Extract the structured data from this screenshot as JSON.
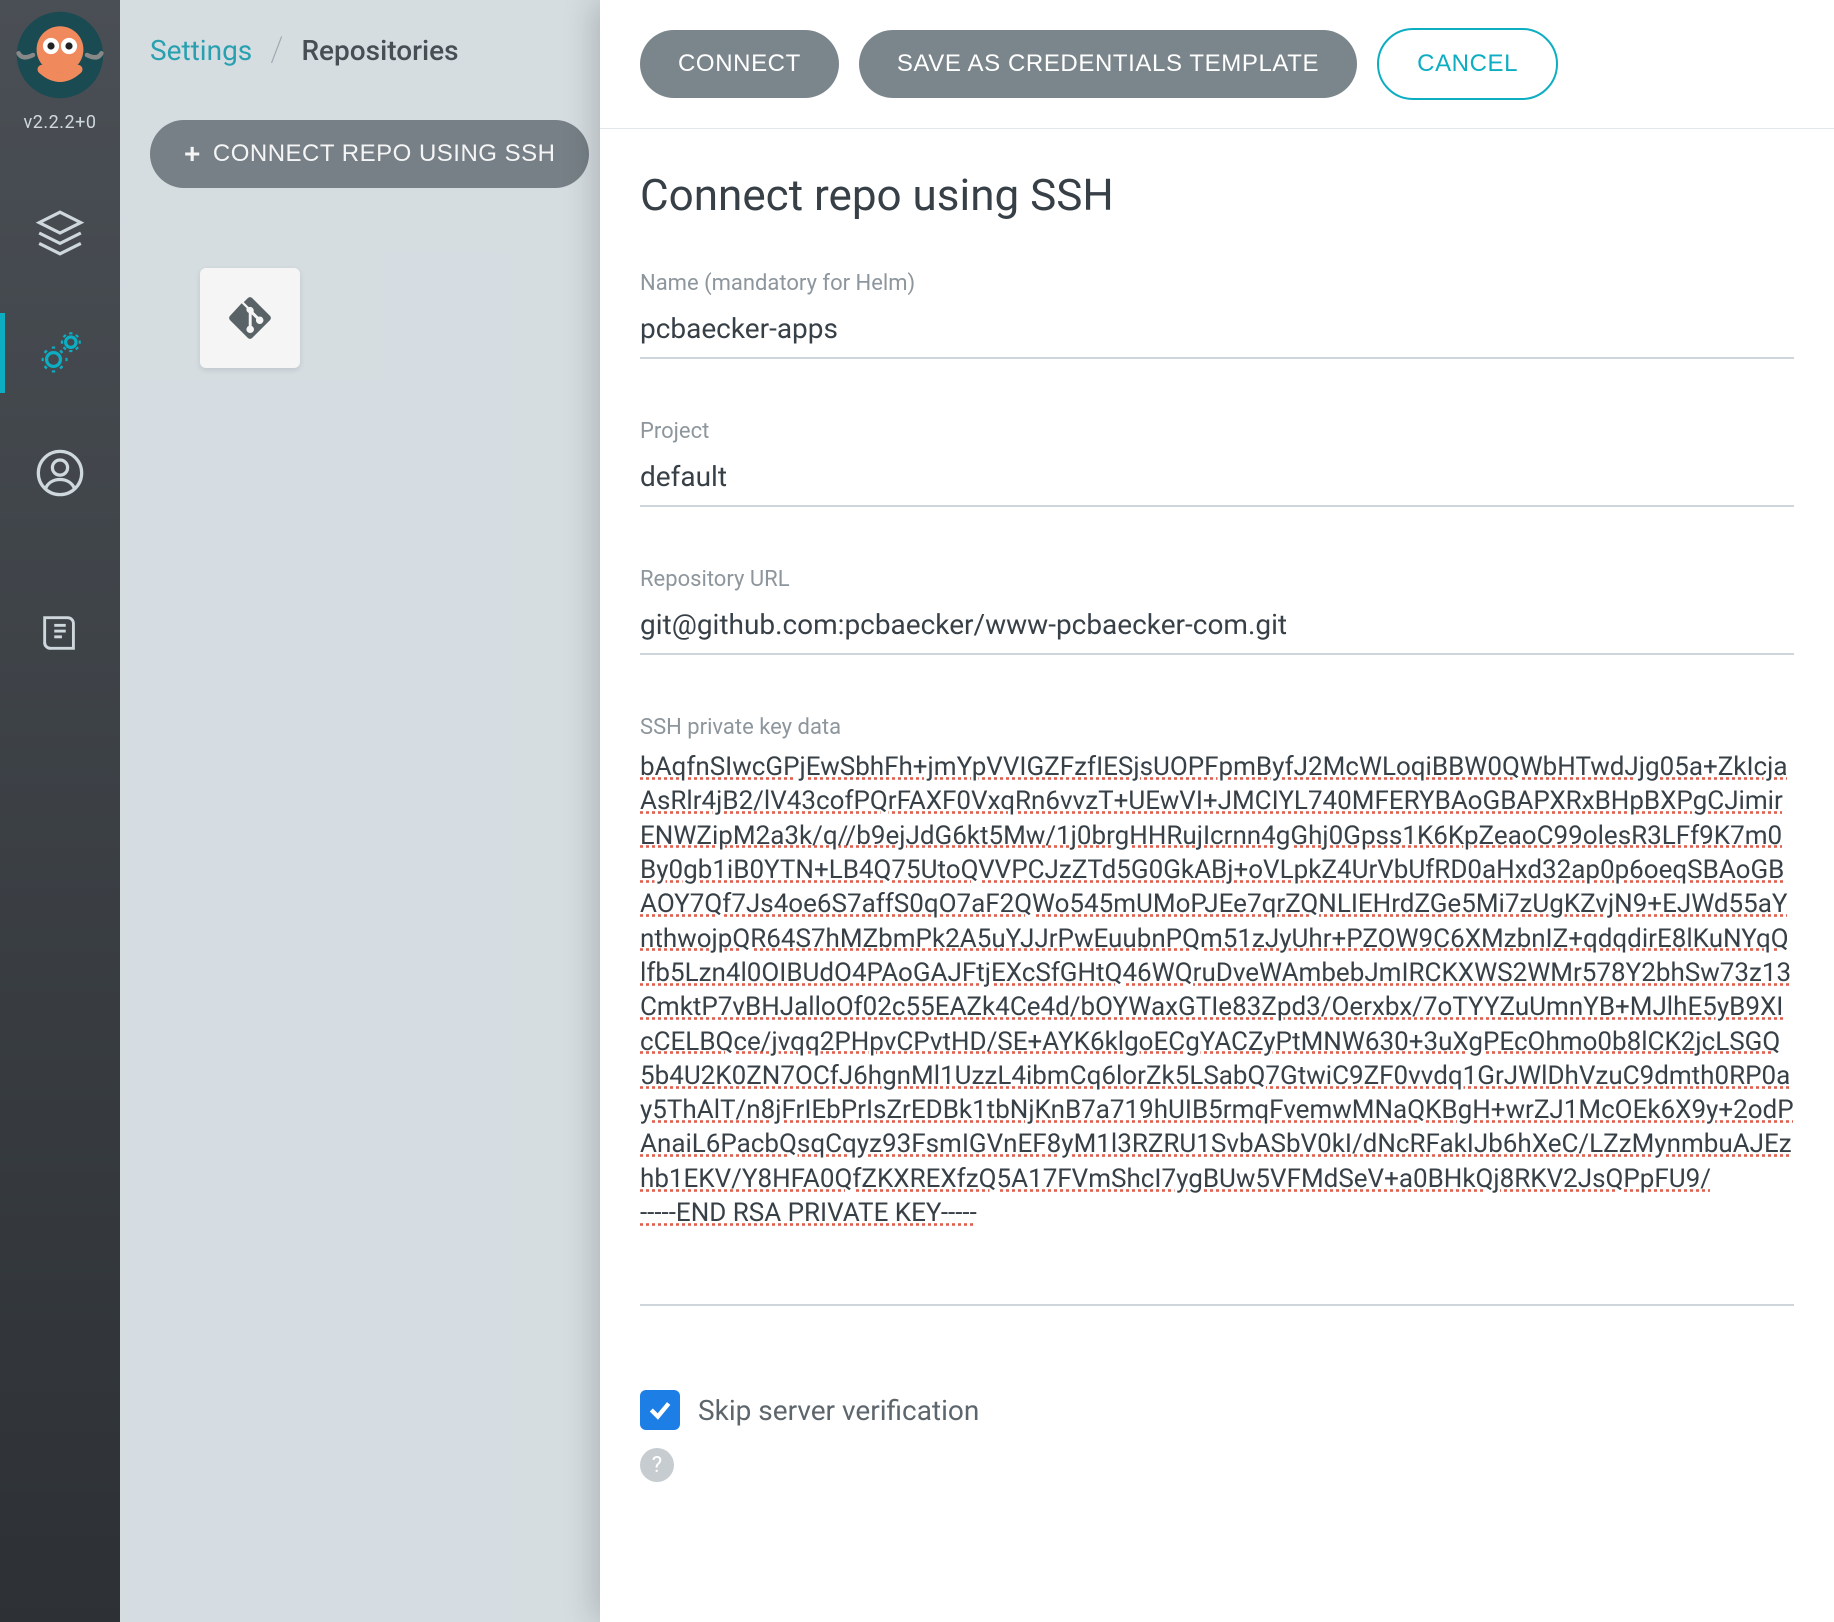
{
  "version": "v2.2.2+0",
  "breadcrumb": {
    "link": "Settings",
    "current": "Repositories"
  },
  "toolbar": {
    "connect_ssh_button": "CONNECT REPO USING SSH"
  },
  "panel": {
    "buttons": {
      "connect": "CONNECT",
      "save_template": "SAVE AS CREDENTIALS TEMPLATE",
      "cancel": "CANCEL"
    },
    "title": "Connect repo using SSH",
    "fields": {
      "name": {
        "label": "Name (mandatory for Helm)",
        "value": "pcbaecker-apps"
      },
      "project": {
        "label": "Project",
        "value": "default"
      },
      "repo_url": {
        "label": "Repository URL",
        "value": "git@github.com:pcbaecker/www-pcbaecker-com.git"
      },
      "ssh_key": {
        "label": "SSH private key data",
        "value": "bAqfnSIwcGPjEwSbhFh+jmYpVVIGZFzfIESjsUOPFpmByfJ2McWLoqiBBW0QWbHTwdJjg05a+ZkIcjaAsRlr4jB2/lV43cofPQrFAXF0VxqRn6vvzT+UEwVI+JMCIYL740MFERYBAoGBAPXRxBHpBXPgCJimirENWZipM2a3k/q//b9ejJdG6kt5Mw/1j0brgHHRujIcrnn4gGhj0Gpss1K6KpZeaoC99olesR3LFf9K7m0By0gb1iB0YTN+LB4Q75UtoQVVPCJzZTd5G0GkABj+oVLpkZ4UrVbUfRD0aHxd32ap0p6oeqSBAoGBAOY7Qf7Js4oe6S7affS0qO7aF2QWo545mUMoPJEe7qrZQNLIEHrdZGe5Mi7zUgKZvjN9+EJWd55aYnthwojpQR64S7hMZbmPk2A5uYJJrPwEuubnPQm51zJyUhr+PZOW9C6XMzbnIZ+qdqdirE8lKuNYqQlfb5Lzn4l0OIBUdO4PAoGAJFtjEXcSfGHtQ46WQruDveWAmbebJmIRCKXWS2WMr578Y2bhSw73z13CmktP7vBHJalloOf02c55EAZk4Ce4d/bOYWaxGTIe83Zpd3/Oerxbx/7oTYYZuUmnYB+MJlhE5yB9XIcCELBQce/jvqq2PHpvCPvtHD/SE+AYK6klgoECgYACZyPtMNW630+3uXgPEcOhmo0b8lCK2jcLSGQ5b4U2K0ZN7OCfJ6hgnMl1UzzL4ibmCq6lorZk5LSabQ7GtwiC9ZF0vvdq1GrJWlDhVzuC9dmth0RP0ay5ThAlT/n8jFrIEbPrIsZrEDBk1tbNjKnB7a719hUIB5rmqFvemwMNaQKBgH+wrZJ1McOEk6X9y+2odPAnaiL6PacbQsqCqyz93FsmIGVnEF8yM1l3RZRU1SvbASbV0kI/dNcRFakIJb6hXeC/LZzMynmbuAJEzhb1EKV/Y8HFA0QfZKXREXfzQ5A17FVmShcI7ygBUw5VFMdSeV+a0BHkQj8RKV2JsQPpFU9/\n-----END RSA PRIVATE KEY-----"
      }
    },
    "skip_verification": {
      "label": "Skip server verification",
      "checked": true
    }
  }
}
